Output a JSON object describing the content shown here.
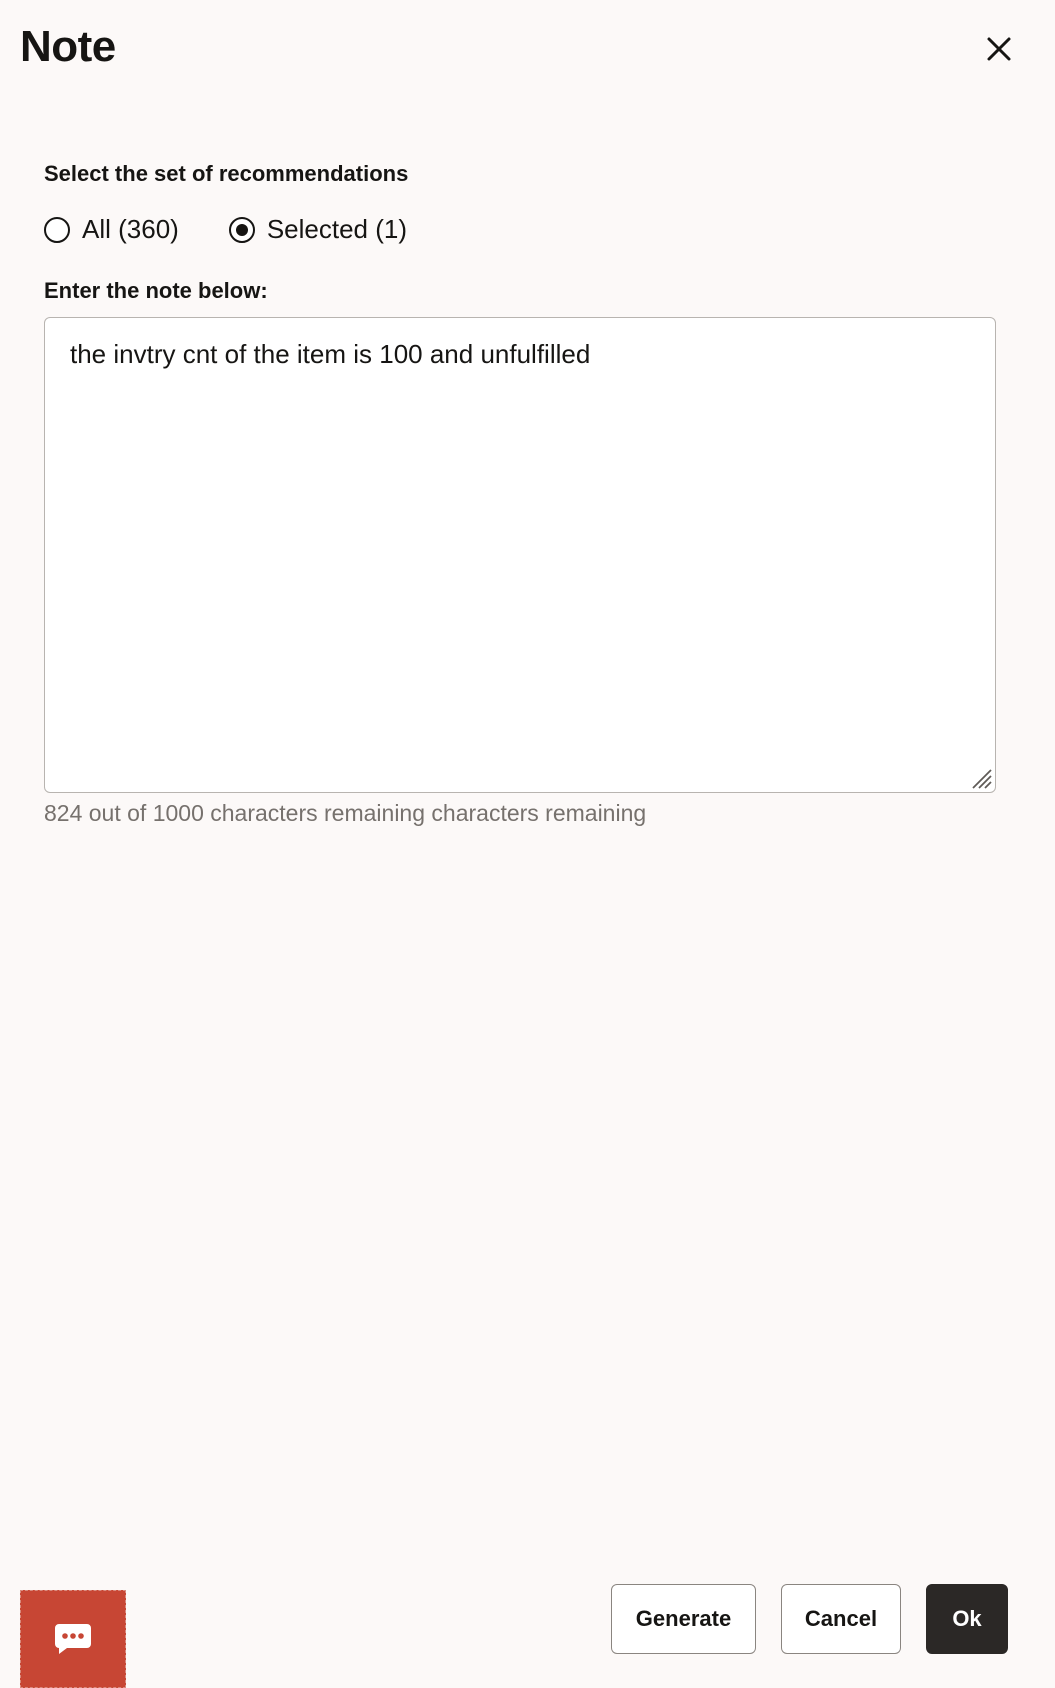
{
  "dialog": {
    "title": "Note",
    "close_icon": "close-icon"
  },
  "recommendations": {
    "label": "Select the set of recommendations",
    "options": [
      {
        "label": "All (360)",
        "selected": false
      },
      {
        "label": "Selected (1)",
        "selected": true
      }
    ]
  },
  "note": {
    "label": "Enter the note below:",
    "value": "the invtry cnt of the item is 100 and unfulfilled",
    "counter": "824 out of 1000 characters remaining characters remaining"
  },
  "footer": {
    "generate_label": "Generate",
    "cancel_label": "Cancel",
    "ok_label": "Ok",
    "feedback_icon": "chat-bubble-icon"
  },
  "colors": {
    "primary_button": "#2b2826",
    "feedback_button": "#c74634",
    "background": "#fcf9f8"
  }
}
